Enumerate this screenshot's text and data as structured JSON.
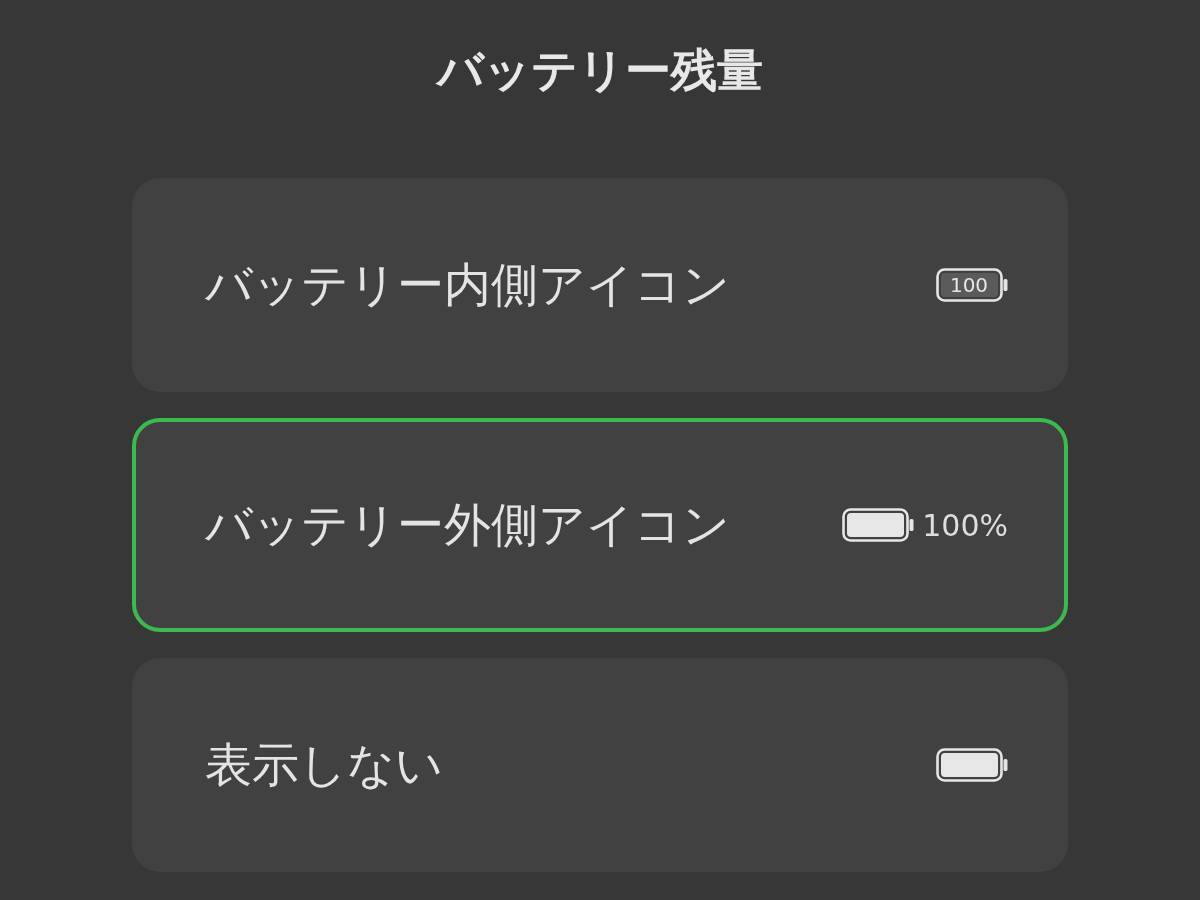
{
  "title": "バッテリー残量",
  "options": [
    {
      "label": "バッテリー内側アイコン",
      "kind": "inside",
      "selected": false,
      "battery_text": "100"
    },
    {
      "label": "バッテリー外側アイコン",
      "kind": "outside",
      "selected": true,
      "battery_text": "100%"
    },
    {
      "label": "表示しない",
      "kind": "none",
      "selected": false
    }
  ]
}
